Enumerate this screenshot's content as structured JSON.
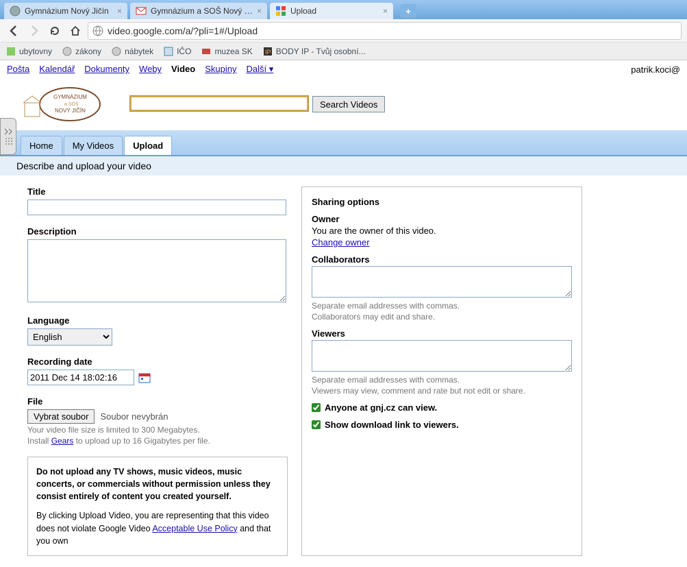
{
  "browser": {
    "tabs": [
      {
        "title": "Gymnázium Nový Jičín"
      },
      {
        "title": "Gymnázium a SOŠ Nový Jičín M"
      },
      {
        "title": "Upload"
      }
    ],
    "url": "video.google.com/a/?pli=1#/Upload",
    "bookmarks": [
      {
        "label": "ubytovny"
      },
      {
        "label": "zákony"
      },
      {
        "label": "nábytek"
      },
      {
        "label": "IČO"
      },
      {
        "label": "muzea SK"
      },
      {
        "label": "BODY IP - Tvůj osobní..."
      }
    ]
  },
  "nav": {
    "links": [
      "Pošta",
      "Kalendář",
      "Dokumenty",
      "Weby"
    ],
    "active": "Video",
    "links2": [
      "Skupiny"
    ],
    "more": "Další ▾",
    "user": "patrik.koci@"
  },
  "logo": {
    "line1": "GYMNÁZIUM",
    "line2": "a SOŠ",
    "line3": "NOVÝ JIČÍN"
  },
  "search": {
    "button": "Search Videos"
  },
  "page_tabs": {
    "home": "Home",
    "myvideos": "My Videos",
    "upload": "Upload"
  },
  "subtitle": "Describe and upload your video",
  "left": {
    "title_label": "Title",
    "description_label": "Description",
    "language_label": "Language",
    "language_value": "English",
    "date_label": "Recording date",
    "date_value": "2011 Dec 14 18:02:16",
    "file_label": "File",
    "file_button": "Vybrat soubor",
    "file_none": "Soubor nevybrán",
    "hint_size": "Your video file size is limited to 300 Megabytes.",
    "hint_gears_pre": "Install ",
    "hint_gears_link": "Gears",
    "hint_gears_post": " to upload up to 16 Gigabytes per file.",
    "notice_bold": "Do not upload any TV shows, music videos, music concerts, or commercials without permission unless they consist entirely of content you created yourself.",
    "notice_rest_pre": "By clicking Upload Video, you are representing that this video does not violate Google Video ",
    "notice_link": "Acceptable Use Policy",
    "notice_rest_post": " and that you own"
  },
  "right": {
    "header": "Sharing options",
    "owner_label": "Owner",
    "owner_text": "You are the owner of this video.",
    "change_owner": "Change owner",
    "collab_label": "Collaborators",
    "collab_hint1": "Separate email addresses with commas.",
    "collab_hint2": "Collaborators may edit and share.",
    "viewers_label": "Viewers",
    "viewers_hint1": "Separate email addresses with commas.",
    "viewers_hint2": "Viewers may view, comment and rate but not edit or share.",
    "cb1": "Anyone at gnj.cz can view.",
    "cb2": "Show download link to viewers."
  }
}
